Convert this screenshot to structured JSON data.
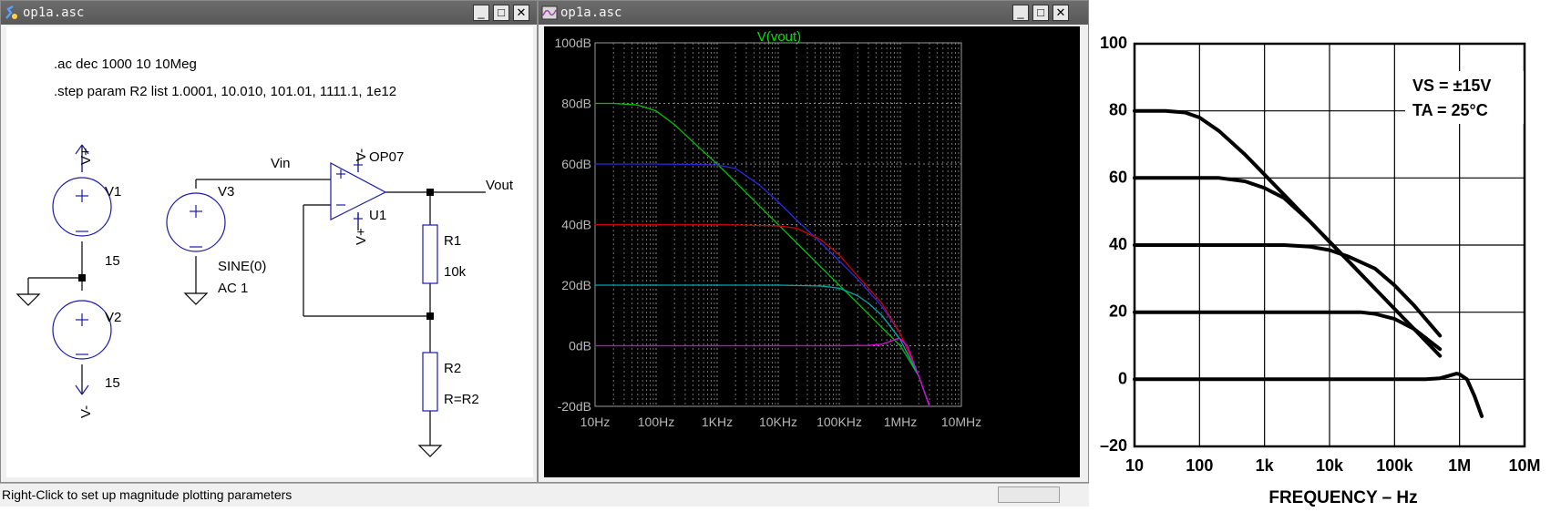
{
  "schematic_window": {
    "title": "op1a.asc",
    "directive_ac": ".ac dec 1000 10 10Meg",
    "directive_step": ".step param R2 list 1.0001, 10.010, 101.01, 1111.1, 1e12",
    "components": {
      "v1_name": "V1",
      "v1_value": "15",
      "v2_name": "V2",
      "v2_value": "15",
      "v3_name": "V3",
      "v3_value1": "SINE(0)",
      "v3_value2": "AC 1",
      "opamp_model": "OP07",
      "opamp_name": "U1",
      "r1_name": "R1",
      "r1_value": "10k",
      "r2_name": "R2",
      "r2_value": "R=R2",
      "net_vin": "Vin",
      "net_vout": "Vout",
      "vplus_label": "V+",
      "vminus_label": "V-"
    }
  },
  "waveform_window": {
    "title": "op1a.asc",
    "trace_label": "V(vout)",
    "y_ticks": [
      "100dB",
      "80dB",
      "60dB",
      "40dB",
      "20dB",
      "0dB",
      "-20dB"
    ],
    "x_ticks": [
      "10Hz",
      "100Hz",
      "1KHz",
      "10KHz",
      "100KHz",
      "1MHz",
      "10MHz"
    ],
    "colors": {
      "background": "#000000",
      "trace_label": "#00ff00",
      "grid": "#8a8a8a"
    },
    "chart_data": {
      "type": "line",
      "x_scale": "log",
      "xlim": [
        10,
        10000000
      ],
      "ylim": [
        -20,
        100
      ],
      "xlabel": "",
      "ylabel": "",
      "series": [
        {
          "color": "#00c000",
          "x": [
            10,
            20,
            50,
            100,
            200,
            500,
            1000,
            2000,
            5000,
            10000,
            20000,
            50000,
            100000,
            200000,
            500000,
            1000000,
            2000000,
            3000000
          ],
          "y": [
            80,
            80,
            79.5,
            77.5,
            73,
            65.5,
            60,
            54,
            46,
            40,
            34,
            26,
            20,
            14,
            6,
            0,
            -10,
            -20
          ]
        },
        {
          "color": "#2a2ae0",
          "x": [
            10,
            100,
            1000,
            2000,
            5000,
            10000,
            20000,
            50000,
            100000,
            200000,
            500000,
            1000000,
            2000000,
            3000000
          ],
          "y": [
            60,
            60,
            59.7,
            58.5,
            53,
            47.5,
            41.5,
            34,
            28,
            22,
            13,
            4,
            -10,
            -20
          ]
        },
        {
          "color": "#cc0000",
          "x": [
            10,
            100,
            1000,
            10000,
            20000,
            50000,
            100000,
            200000,
            500000,
            1000000,
            2000000,
            3000000
          ],
          "y": [
            40,
            40,
            40,
            39.6,
            38.8,
            35,
            30,
            23,
            14,
            4,
            -10,
            -20
          ]
        },
        {
          "color": "#00aaaa",
          "x": [
            10,
            100,
            1000,
            10000,
            50000,
            100000,
            200000,
            300000,
            500000,
            1000000,
            2000000,
            3000000
          ],
          "y": [
            20,
            20,
            20,
            20,
            19.7,
            19,
            16.5,
            14,
            10,
            2,
            -10,
            -20
          ]
        },
        {
          "color": "#dd00dd",
          "x": [
            10,
            100,
            1000,
            10000,
            100000,
            300000,
            500000,
            700000,
            900000,
            1000000,
            1300000,
            2000000,
            3000000
          ],
          "y": [
            0,
            0,
            0,
            0,
            0,
            0.1,
            0.5,
            1.5,
            2.4,
            2.3,
            0,
            -10,
            -20
          ]
        }
      ]
    }
  },
  "status_text": "Right-Click to set up magnitude plotting parameters",
  "datasheet_chart": {
    "annotation_line1": "VS = ±15V",
    "annotation_line2": "TA = 25°C",
    "x_ticks": [
      "10",
      "100",
      "1k",
      "10k",
      "100k",
      "1M",
      "10M"
    ],
    "y_ticks": [
      "100",
      "80",
      "60",
      "40",
      "20",
      "0",
      "–20"
    ],
    "chart_data": {
      "type": "line",
      "x_scale": "log",
      "xlim": [
        10,
        10000000
      ],
      "ylim": [
        -20,
        100
      ],
      "xlabel": "FREQUENCY – Hz",
      "ylabel": "",
      "series": [
        {
          "x": [
            10,
            30,
            60,
            100,
            200,
            500,
            1000,
            2000,
            5000,
            10000,
            20000,
            50000,
            100000,
            200000,
            500000
          ],
          "y": [
            80,
            80,
            79.5,
            78,
            74,
            67,
            61,
            55,
            47,
            41,
            35,
            27,
            21,
            15,
            7
          ]
        },
        {
          "x": [
            10,
            100,
            200,
            500,
            1000,
            2000,
            5000,
            10000,
            20000,
            50000
          ],
          "y": [
            60,
            60,
            60,
            59,
            57,
            54,
            47,
            41,
            35,
            27
          ]
        },
        {
          "x": [
            10,
            100,
            1000,
            2000,
            5000,
            10000,
            20000,
            50000,
            100000,
            200000,
            500000
          ],
          "y": [
            40,
            40,
            40,
            40,
            39.5,
            38.5,
            36.5,
            33,
            28,
            22,
            13
          ]
        },
        {
          "x": [
            10,
            100,
            1000,
            10000,
            30000,
            50000,
            100000,
            200000,
            500000
          ],
          "y": [
            20,
            20,
            20,
            20,
            20,
            19.5,
            18,
            15,
            9
          ]
        },
        {
          "x": [
            10,
            100,
            1000,
            10000,
            100000,
            300000,
            500000,
            700000,
            900000,
            1000000,
            1300000,
            1700000,
            2200000
          ],
          "y": [
            0,
            0,
            0,
            0,
            0,
            0,
            0.3,
            1.1,
            1.7,
            1.5,
            0,
            -5,
            -11
          ]
        }
      ]
    }
  }
}
